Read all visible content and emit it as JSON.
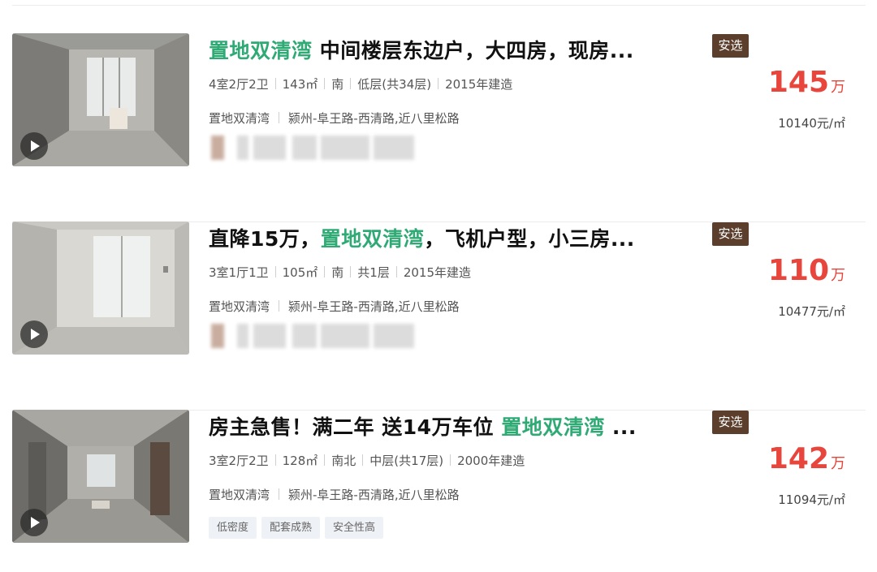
{
  "listings": [
    {
      "title_parts": [
        {
          "text": "置地双清湾",
          "highlight": true
        },
        {
          "text": " 中间楼层东边户，大四房，现房...",
          "highlight": false
        }
      ],
      "badge": "安选",
      "layout": "4室2厅2卫",
      "area": "143㎡",
      "orientation": "南",
      "floor": "低层(共34层)",
      "year": "2015年建造",
      "community": "置地双清湾",
      "location": "颍州-阜王路-西清路,近八里松路",
      "tags": [],
      "price": "145",
      "price_unit": "万",
      "unit_price": "10140元/㎡"
    },
    {
      "title_parts": [
        {
          "text": "直降15万，",
          "highlight": false
        },
        {
          "text": "置地双清湾",
          "highlight": true
        },
        {
          "text": "，飞机户型，小三房...",
          "highlight": false
        }
      ],
      "badge": "安选",
      "layout": "3室1厅1卫",
      "area": "105㎡",
      "orientation": "南",
      "floor": "共1层",
      "year": "2015年建造",
      "community": "置地双清湾",
      "location": "颍州-阜王路-西清路,近八里松路",
      "tags": [],
      "price": "110",
      "price_unit": "万",
      "unit_price": "10477元/㎡"
    },
    {
      "title_parts": [
        {
          "text": "房主急售！满二年 送14万车位 ",
          "highlight": false
        },
        {
          "text": "置地双清湾",
          "highlight": true
        },
        {
          "text": " ...",
          "highlight": false
        }
      ],
      "badge": "安选",
      "layout": "3室2厅2卫",
      "area": "128㎡",
      "orientation": "南北",
      "floor": "中层(共17层)",
      "year": "2000年建造",
      "community": "置地双清湾",
      "location": "颍州-阜王路-西清路,近八里松路",
      "tags": [
        "低密度",
        "配套成熟",
        "安全性高"
      ],
      "price": "142",
      "price_unit": "万",
      "unit_price": "11094元/㎡"
    }
  ],
  "icons": {
    "play": "play-icon"
  },
  "colors": {
    "highlight": "#2faa74",
    "price": "#e8463c",
    "badge_bg": "#5b3e2b"
  }
}
